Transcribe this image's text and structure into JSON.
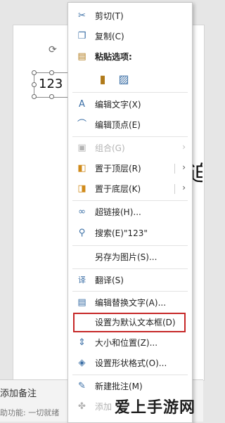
{
  "slide": {
    "textbox_text": "123",
    "partial_glyph": "迫"
  },
  "notes_bar": {
    "label": "添加备注"
  },
  "status_bar": {
    "text": "助功能: 一切就绪"
  },
  "menu": {
    "items": [
      {
        "name": "cut",
        "label": "剪切(T)",
        "icon": "scissors-icon",
        "glyph": "✂"
      },
      {
        "name": "copy",
        "label": "复制(C)",
        "icon": "copy-icon",
        "glyph": "❐"
      },
      {
        "name": "paste-options",
        "label": "粘贴选项:",
        "icon": "clipboard-icon",
        "glyph": "📋"
      },
      {
        "name": "edit-text",
        "label": "编辑文字(X)",
        "icon": "edit-text-icon",
        "glyph": "A"
      },
      {
        "name": "edit-points",
        "label": "编辑顶点(E)",
        "icon": "edit-points-icon",
        "glyph": "⌒"
      },
      {
        "name": "group",
        "label": "组合(G)",
        "icon": "group-icon",
        "glyph": "▣",
        "disabled": true,
        "submenu": true
      },
      {
        "name": "bring-to-front",
        "label": "置于顶层(R)",
        "icon": "bring-front-icon",
        "glyph": "◧",
        "submenu": true
      },
      {
        "name": "send-to-back",
        "label": "置于底层(K)",
        "icon": "send-back-icon",
        "glyph": "◨",
        "submenu": true
      },
      {
        "name": "hyperlink",
        "label": "超链接(H)...",
        "icon": "link-icon",
        "glyph": "⊂⊃"
      },
      {
        "name": "search",
        "label": "搜索(E)\"123\"",
        "icon": "search-icon",
        "glyph": "⚲"
      },
      {
        "name": "save-as-picture",
        "label": "另存为图片(S)...",
        "icon": "",
        "glyph": ""
      },
      {
        "name": "translate",
        "label": "翻译(S)",
        "icon": "translate-icon",
        "glyph": "译"
      },
      {
        "name": "edit-alt-text",
        "label": "编辑替换文字(A)...",
        "icon": "alt-text-icon",
        "glyph": "▤"
      },
      {
        "name": "set-default-textbox",
        "label": "设置为默认文本框(D)",
        "icon": "",
        "glyph": ""
      },
      {
        "name": "size-position",
        "label": "大小和位置(Z)...",
        "icon": "size-position-icon",
        "glyph": "⇕"
      },
      {
        "name": "format-shape",
        "label": "设置形状格式(O)...",
        "icon": "format-shape-icon",
        "glyph": "◈"
      },
      {
        "name": "new-comment",
        "label": "新建批注(M)",
        "icon": "comment-icon",
        "glyph": "✎"
      },
      {
        "name": "add-note",
        "label": "添加",
        "icon": "note-icon",
        "glyph": "✤",
        "disabled": true
      }
    ],
    "paste_options": [
      {
        "name": "paste-keep-source-icon",
        "glyph": "📋"
      },
      {
        "name": "paste-picture-icon",
        "glyph": "🖼"
      }
    ],
    "highlight_color": "#c62828"
  },
  "watermark": {
    "text": "爱上手游网"
  }
}
